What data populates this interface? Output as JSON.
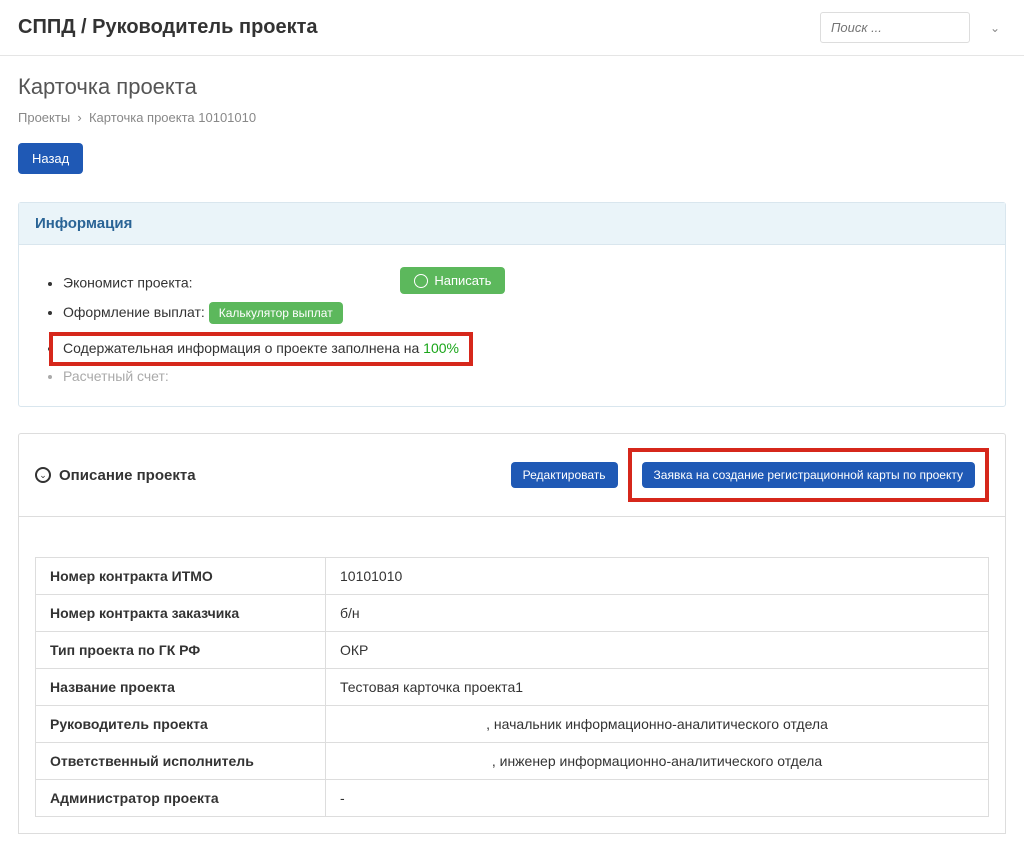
{
  "topbar": {
    "title": "СППД / Руководитель проекта",
    "search_placeholder": "Поиск ..."
  },
  "page": {
    "title": "Карточка проекта",
    "breadcrumb": {
      "root": "Проекты",
      "current": "Карточка проекта 10101010"
    },
    "back_label": "Назад"
  },
  "info_panel": {
    "heading": "Информация",
    "items": {
      "economist_label": "Экономист проекта:",
      "payments_label": "Оформление выплат:",
      "calc_btn": "Калькулятор выплат",
      "write_btn": "Написать",
      "content_filled_prefix": "Содержательная информация о проекте заполнена на ",
      "content_filled_pct": "100%",
      "account_label": "Расчетный счет:"
    }
  },
  "desc_section": {
    "title": "Описание проекта",
    "edit_btn": "Редактировать",
    "create_card_btn": "Заявка на создание регистрационной карты по проекту",
    "rows": [
      {
        "label": "Номер контракта ИТМО",
        "value": "10101010"
      },
      {
        "label": "Номер контракта заказчика",
        "value": "б/н"
      },
      {
        "label": "Тип проекта по ГК РФ",
        "value": "ОКР"
      },
      {
        "label": "Название проекта",
        "value": "Тестовая карточка проекта1"
      },
      {
        "label": "Руководитель проекта",
        "value": ", начальник информационно-аналитического отдела"
      },
      {
        "label": "Ответственный исполнитель",
        "value": ", инженер информационно-аналитического отдела"
      },
      {
        "label": "Администратор проекта",
        "value": "-"
      }
    ]
  }
}
